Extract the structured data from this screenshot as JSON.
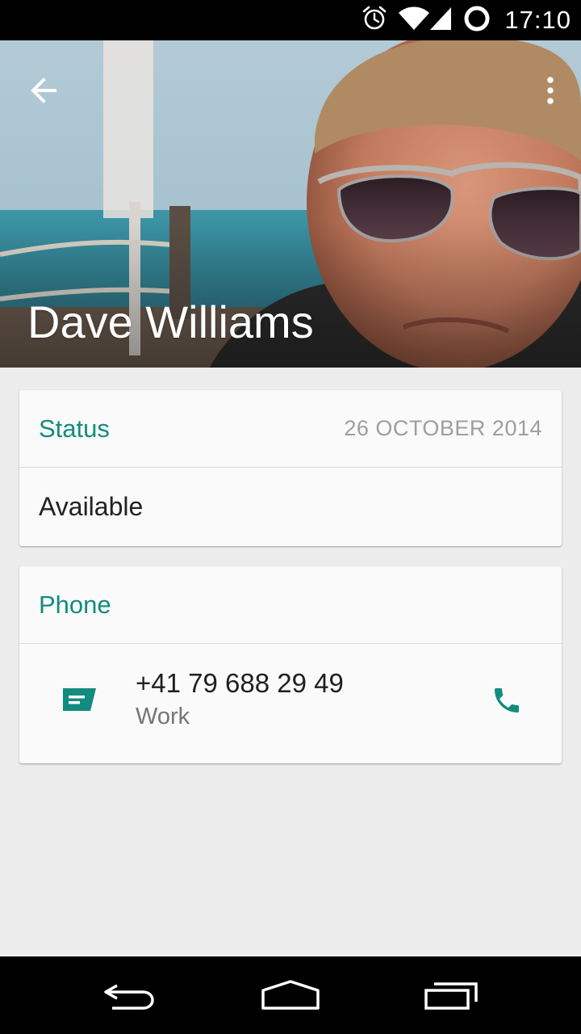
{
  "status_bar": {
    "time": "17:10",
    "icons": [
      "alarm-icon",
      "wifi-icon",
      "signal-icon",
      "sync-icon"
    ]
  },
  "header": {
    "contact_name": "Dave Williams",
    "back_icon": "arrow-left-icon",
    "menu_icon": "more-vert-icon"
  },
  "status_section": {
    "title": "Status",
    "date": "26 OCTOBER 2014",
    "text": "Available"
  },
  "phone_section": {
    "title": "Phone",
    "number": "+41 79 688 29 49",
    "type": "Work",
    "message_icon": "message-icon",
    "call_icon": "call-icon"
  },
  "nav_bar": {
    "icons": [
      "back-nav-icon",
      "home-nav-icon",
      "recents-nav-icon"
    ]
  },
  "colors": {
    "accent": "#128c7e",
    "status_bar": "#000000",
    "background": "#ececec",
    "card": "#fafafa"
  }
}
